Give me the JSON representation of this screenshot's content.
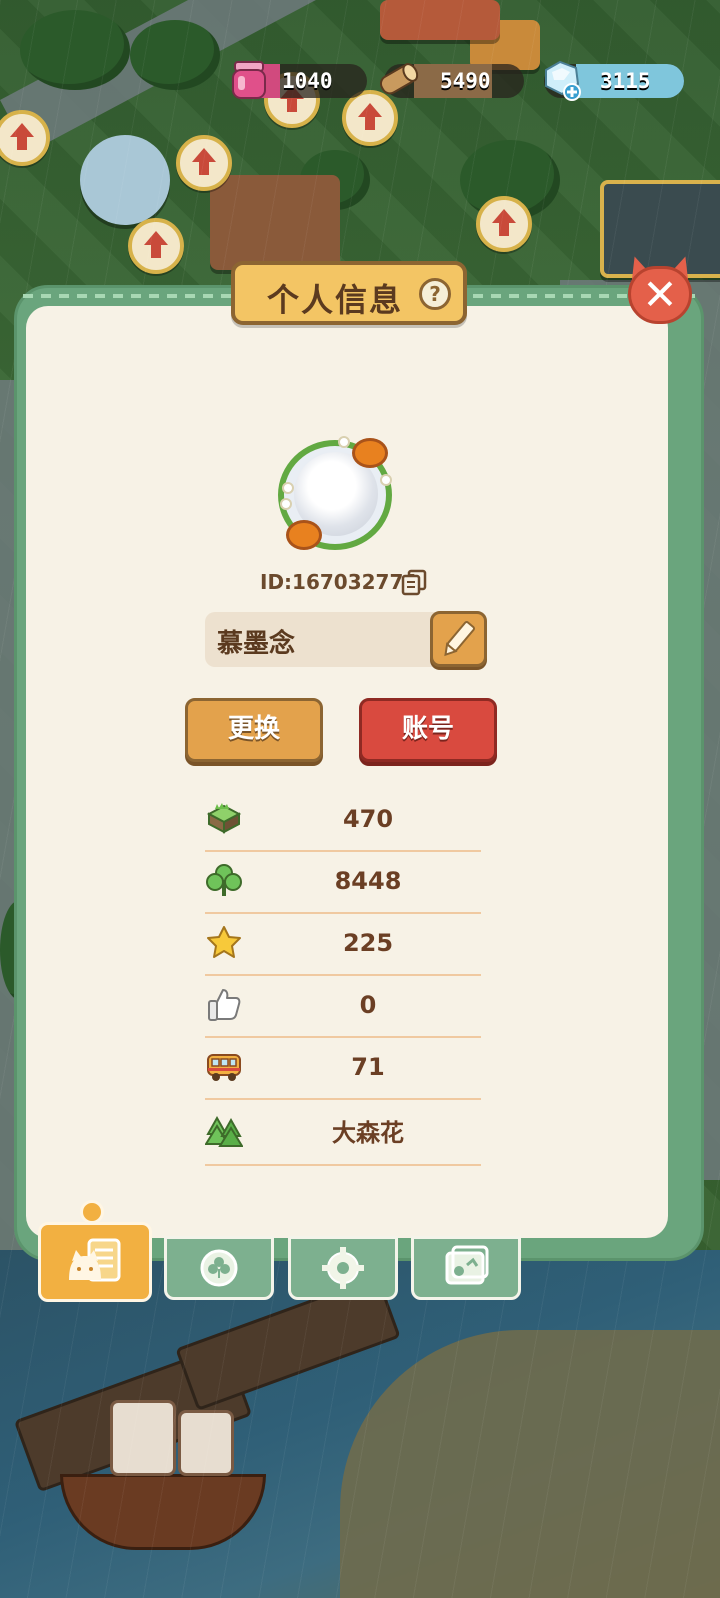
{
  "resources": {
    "jam": {
      "icon": "jam-jar-icon",
      "value": "1040"
    },
    "wood": {
      "icon": "wood-log-icon",
      "value": "5490"
    },
    "gem": {
      "icon": "ice-gem-icon",
      "value": "3115"
    }
  },
  "panel": {
    "title": "个人信息",
    "help_label": "?",
    "close_label": "✕"
  },
  "profile": {
    "avatar": "sheep-avatar-icon",
    "id_text": "ID:167032774",
    "name": "慕墨念",
    "change_label": "更换",
    "account_label": "账号"
  },
  "stats": [
    {
      "icon": "grass-block-icon",
      "value": "470"
    },
    {
      "icon": "clover-icon",
      "value": "8448"
    },
    {
      "icon": "star-icon",
      "value": "225"
    },
    {
      "icon": "thumbs-up-icon",
      "value": "0"
    },
    {
      "icon": "bus-icon",
      "value": "71"
    },
    {
      "icon": "pine-trees-icon",
      "value": "大森花"
    }
  ],
  "tabs": [
    {
      "name": "tab-profile",
      "icon": "cat-card-icon",
      "active": true
    },
    {
      "name": "tab-badges",
      "icon": "clover-badge-icon",
      "active": false
    },
    {
      "name": "tab-settings",
      "icon": "gear-icon",
      "active": false
    },
    {
      "name": "tab-album",
      "icon": "photo-album-icon",
      "active": false
    }
  ],
  "colors": {
    "panel_green": "#6aa57d",
    "panel_cream": "#f7f2e6",
    "title_gold": "#f3c564",
    "button_orange": "#e3a24c",
    "button_red": "#d94a3f",
    "text_brown": "#6b3f24"
  }
}
